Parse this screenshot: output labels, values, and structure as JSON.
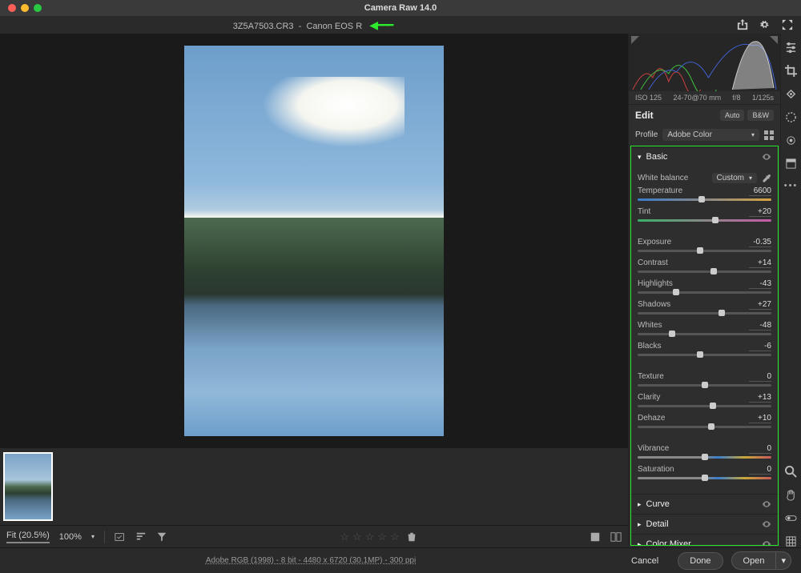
{
  "app": {
    "title": "Camera Raw 14.0"
  },
  "file": {
    "name": "3Z5A7503.CR3",
    "camera": "Canon EOS R"
  },
  "exif": {
    "iso": "ISO 125",
    "lens": "24-70@70 mm",
    "aperture": "f/8",
    "shutter": "1/125s"
  },
  "edit": {
    "title": "Edit",
    "auto": "Auto",
    "bw": "B&W"
  },
  "profile": {
    "label": "Profile",
    "value": "Adobe Color"
  },
  "basic": {
    "title": "Basic",
    "wb_label": "White balance",
    "wb_value": "Custom",
    "sliders": [
      {
        "label": "Temperature",
        "value": "6600",
        "pos": 48,
        "track": "temp"
      },
      {
        "label": "Tint",
        "value": "+20",
        "pos": 58,
        "track": "tint"
      }
    ],
    "tone": [
      {
        "label": "Exposure",
        "value": "-0.35",
        "pos": 47
      },
      {
        "label": "Contrast",
        "value": "+14",
        "pos": 57
      },
      {
        "label": "Highlights",
        "value": "-43",
        "pos": 29
      },
      {
        "label": "Shadows",
        "value": "+27",
        "pos": 63
      },
      {
        "label": "Whites",
        "value": "-48",
        "pos": 26
      },
      {
        "label": "Blacks",
        "value": "-6",
        "pos": 47
      }
    ],
    "presence": [
      {
        "label": "Texture",
        "value": "0",
        "pos": 50
      },
      {
        "label": "Clarity",
        "value": "+13",
        "pos": 56
      },
      {
        "label": "Dehaze",
        "value": "+10",
        "pos": 55
      }
    ],
    "color": [
      {
        "label": "Vibrance",
        "value": "0",
        "pos": 50,
        "track": "vib"
      },
      {
        "label": "Saturation",
        "value": "0",
        "pos": 50,
        "track": "sat"
      }
    ]
  },
  "panels": {
    "curve": "Curve",
    "detail": "Detail",
    "mixer": "Color Mixer"
  },
  "bottom": {
    "fit": "Fit (20.5%)",
    "zoom": "100%",
    "workflow": "Adobe RGB (1998) - 8 bit - 4480 x 6720 (30.1MP) - 300 ppi"
  },
  "footer": {
    "cancel": "Cancel",
    "done": "Done",
    "open": "Open"
  }
}
